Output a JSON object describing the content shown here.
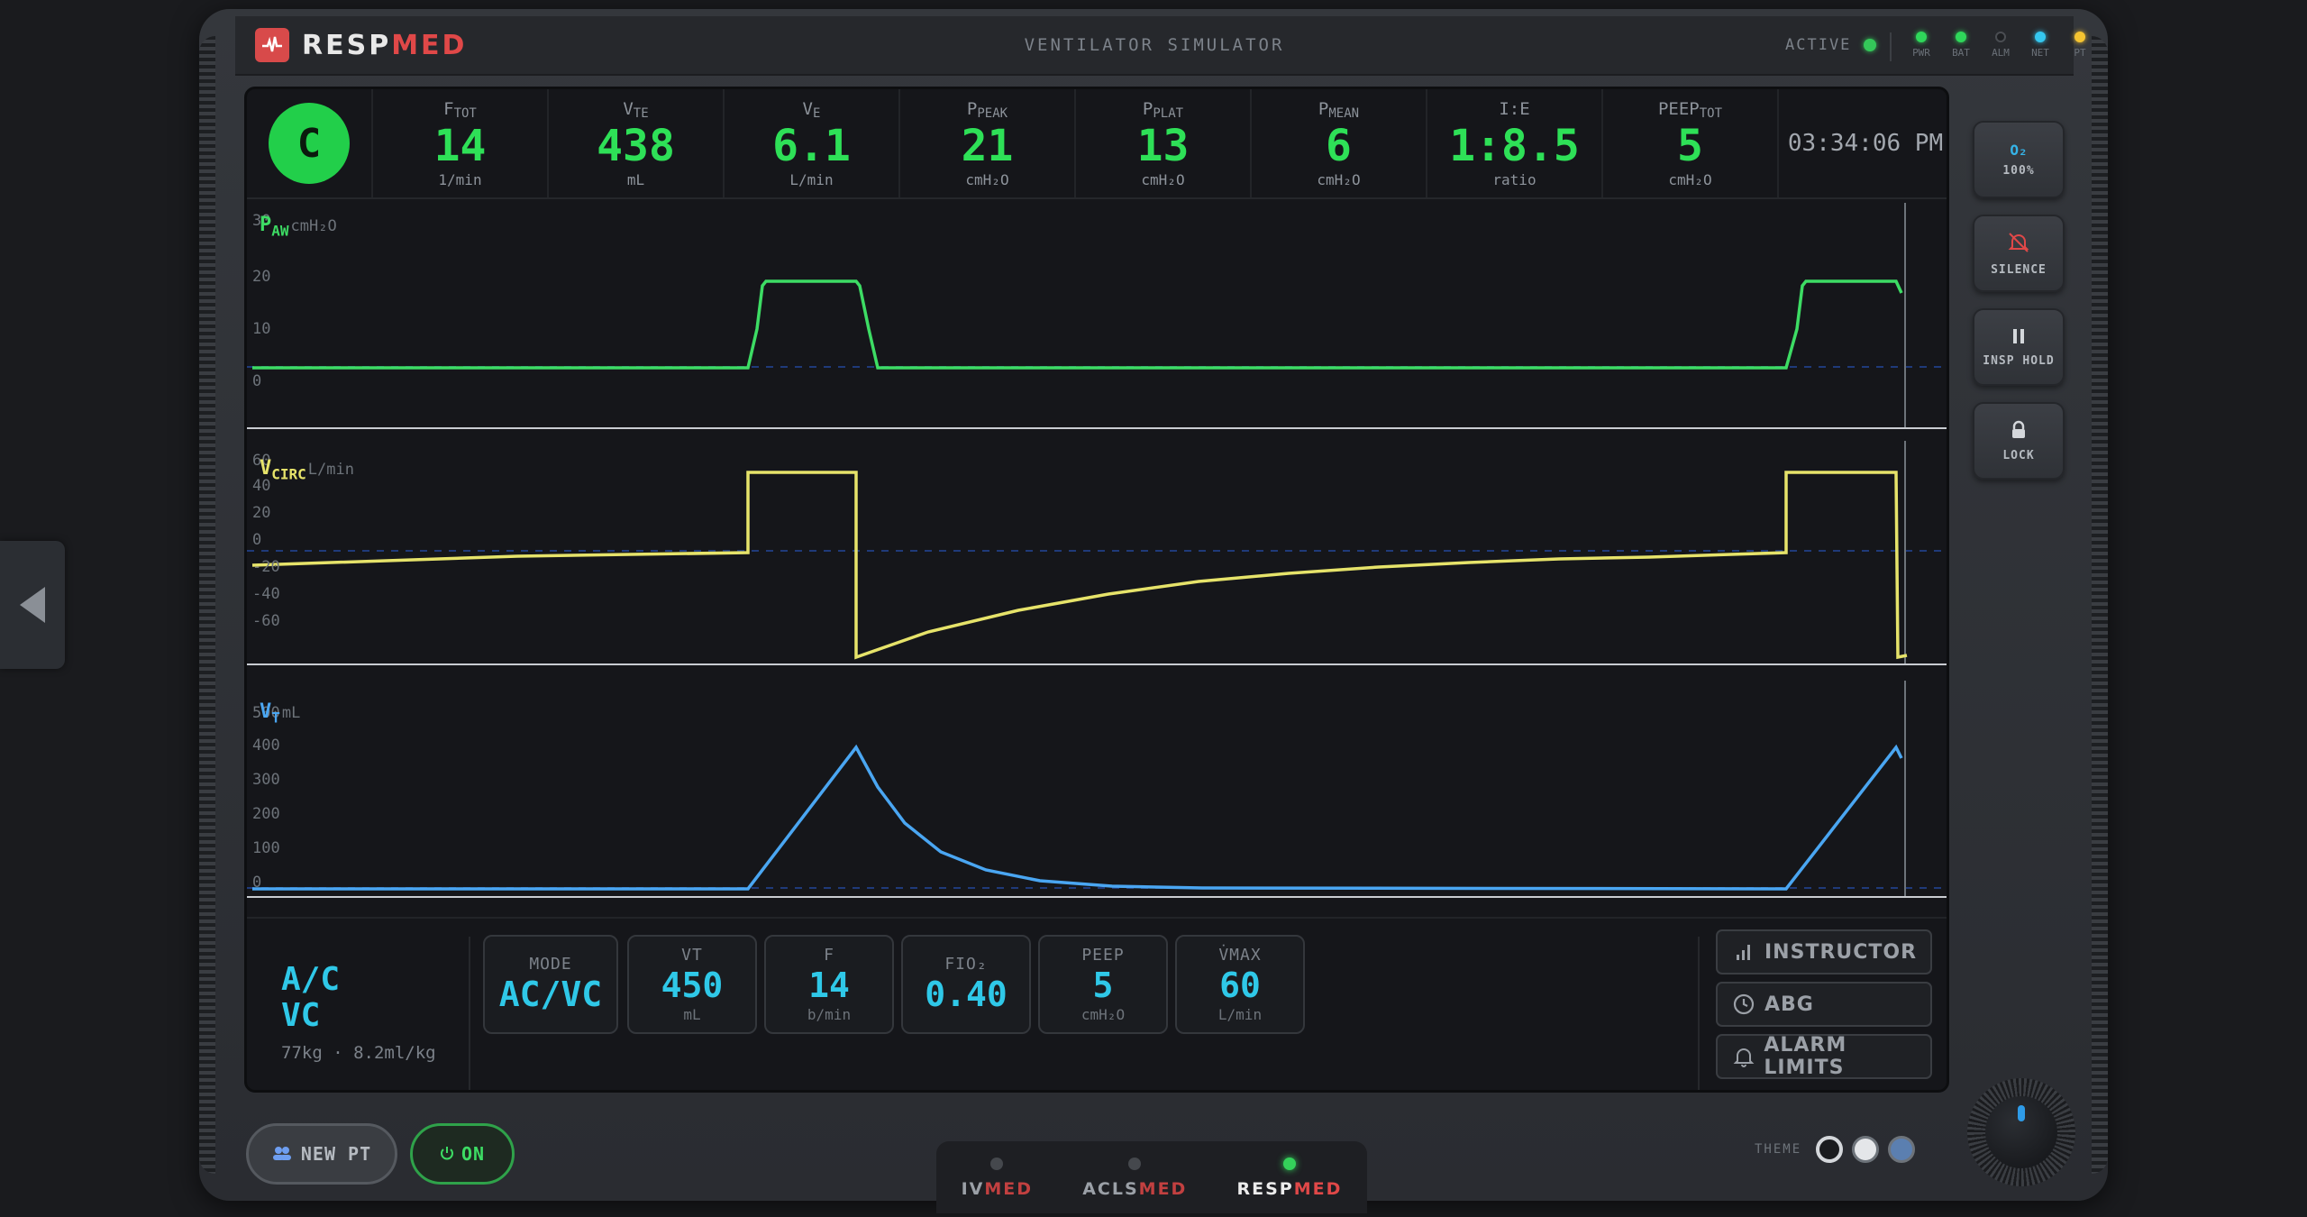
{
  "app": {
    "logo_main": "RESP",
    "logo_accent": "MED",
    "title": "VENTILATOR SIMULATOR",
    "status_label": "ACTIVE",
    "leds": [
      {
        "label": "PWR",
        "color": "#2fd85a"
      },
      {
        "label": "BAT",
        "color": "#2fd85a"
      },
      {
        "label": "ALM",
        "color": "#1d1f22"
      },
      {
        "label": "NET",
        "color": "#35c7ef"
      },
      {
        "label": "PT",
        "color": "#f5c431"
      }
    ]
  },
  "metrics": {
    "mode_badge": "C",
    "items": [
      {
        "label": "F",
        "sub": "TOT",
        "value": "14",
        "unit": "1/min"
      },
      {
        "label": "V",
        "sub": "TE",
        "value": "438",
        "unit": "mL"
      },
      {
        "label": "V",
        "sub": "E",
        "value": "6.1",
        "unit": "L/min"
      },
      {
        "label": "P",
        "sub": "PEAK",
        "value": "21",
        "unit": "cmH₂O"
      },
      {
        "label": "P",
        "sub": "PLAT",
        "value": "13",
        "unit": "cmH₂O"
      },
      {
        "label": "P",
        "sub": "MEAN",
        "value": "6",
        "unit": "cmH₂O"
      },
      {
        "label": "I:E",
        "sub": "",
        "value": "1:8.5",
        "unit": "ratio"
      },
      {
        "label": "PEEP",
        "sub": "TOT",
        "value": "5",
        "unit": "cmH₂O"
      }
    ],
    "clock": "03:34:06 PM"
  },
  "waveforms": [
    {
      "label": "P",
      "sub": "AW",
      "unit": "cmH₂O",
      "color": "#3ddc64",
      "ticks": [
        "30",
        "20",
        "10",
        "0"
      ]
    },
    {
      "label": "V",
      "sub": "CIRC",
      "unit": "L/min",
      "color": "#e6e36a",
      "ticks": [
        "60",
        "40",
        "20",
        "0",
        "-20",
        "-40",
        "-60"
      ]
    },
    {
      "label": "V",
      "sub": "T",
      "unit": "mL",
      "color": "#4aa6f2",
      "ticks": [
        "500",
        "400",
        "300",
        "200",
        "100",
        "0"
      ]
    }
  ],
  "controls": {
    "mode_line1": "A/C",
    "mode_line2": "VC",
    "patient": "77kg · 8.2ml/kg",
    "settings": [
      {
        "label": "MODE",
        "value": "AC/VC",
        "unit": ""
      },
      {
        "label": "VT",
        "value": "450",
        "unit": "mL"
      },
      {
        "label": "F",
        "value": "14",
        "unit": "b/min"
      },
      {
        "label": "FIO₂",
        "value": "0.40",
        "unit": ""
      },
      {
        "label": "PEEP",
        "value": "5",
        "unit": "cmH₂O"
      },
      {
        "label": "V̇MAX",
        "value": "60",
        "unit": "L/min"
      }
    ],
    "instructor": "INSTRUCTOR",
    "abg": "ABG",
    "alarm_limits": "ALARM LIMITS"
  },
  "side_buttons": {
    "o2_label": "O₂",
    "o2_value": "100%",
    "silence": "SILENCE",
    "insp_hold": "INSP HOLD",
    "lock": "LOCK"
  },
  "footer": {
    "new_pt": "NEW PT",
    "on": "ON",
    "theme_label": "THEME",
    "tabs": [
      {
        "a": "IV",
        "b": "MED",
        "active": false
      },
      {
        "a": "ACLS",
        "b": "MED",
        "active": false
      },
      {
        "a": "RESP",
        "b": "MED",
        "active": true
      }
    ]
  }
}
